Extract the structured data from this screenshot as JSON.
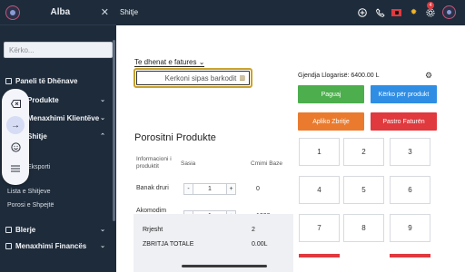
{
  "sidebar": {
    "title": "Alba",
    "close_glyph": "✕",
    "search_placeholder": "Kërko...",
    "items": [
      {
        "label": "Paneli të Dhënave"
      },
      {
        "label": "Produkte"
      },
      {
        "label": "Menaxhimi Klientëve"
      },
      {
        "label": "Shitje"
      },
      {
        "label": "Blerje"
      },
      {
        "label": "Menaxhimi Financës"
      }
    ],
    "sub_items": [
      {
        "label": "Eksporti"
      },
      {
        "label": "Lista e Shitjeve"
      },
      {
        "label": "Porosi e Shpejtë"
      }
    ]
  },
  "floating_toolbar": {
    "icons": [
      "backspace-icon",
      "arrow-right-icon",
      "smile-icon",
      "menu-icon"
    ]
  },
  "topbar": {
    "title": "Shitje",
    "notification_count": "4",
    "icons": [
      "plus-circle-icon",
      "phone-icon",
      "flag-albania-icon",
      "sun-icon",
      "gear-icon",
      "avatar"
    ]
  },
  "main": {
    "invoice_link": "Te dhenat e fatures",
    "barcode_placeholder": "Kerkoni sipas barkodit",
    "section_title": "Porositni Produkte",
    "columns": {
      "info": "Informacioni i produktit",
      "qty": "Sasia",
      "price": "Cmimi Baze"
    },
    "rows": [
      {
        "name": "Banak druri",
        "qty": "1",
        "price": "0"
      },
      {
        "name": "Akomodim hotel",
        "qty": "1",
        "price": "1000"
      }
    ],
    "summary": [
      {
        "label": "Rrjesht",
        "value": "2"
      },
      {
        "label": "ZBRITJA TOTALE",
        "value": "0.00L"
      }
    ]
  },
  "right": {
    "balance": "Gjendja Llogarisë: 6400.00 L",
    "buttons": [
      {
        "label": "Paguaj",
        "color": "#4cae4c"
      },
      {
        "label": "Kërko për produkt",
        "color": "#2f8de4"
      },
      {
        "label": "Apliko Zbritje",
        "color": "#ea7b2e"
      },
      {
        "label": "Pastro Faturën",
        "color": "#e0393e"
      }
    ],
    "keys": [
      "1",
      "2",
      "3",
      "4",
      "5",
      "6",
      "7",
      "8",
      "9"
    ]
  }
}
